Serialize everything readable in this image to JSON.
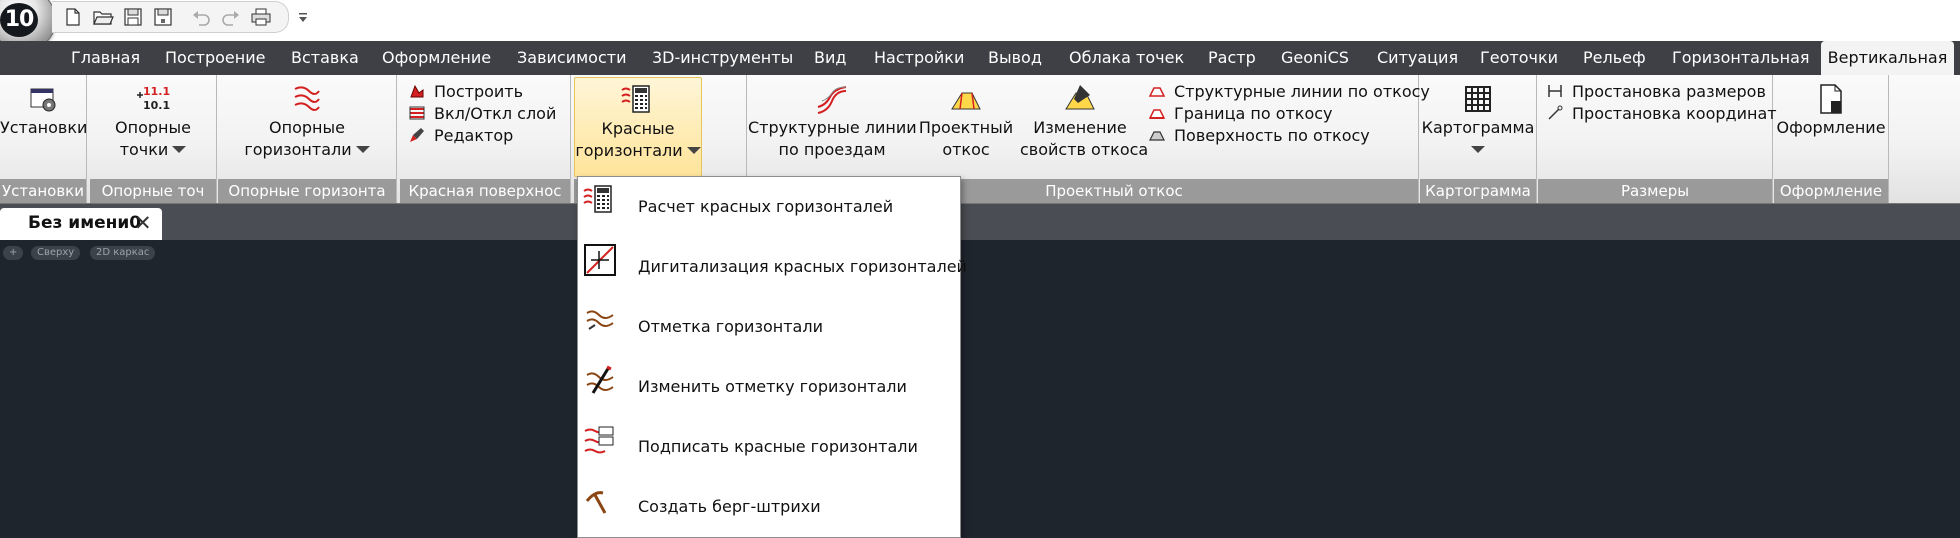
{
  "app": {
    "orb_label": "10"
  },
  "quick_access": {
    "buttons": [
      "new-file-icon",
      "open-folder-icon",
      "save-icon",
      "save-as-icon",
      "undo-icon",
      "redo-icon",
      "print-icon"
    ],
    "customize_icon": "customize-dropdown-icon"
  },
  "menu_tabs": [
    "Главная",
    "Построение",
    "Вставка",
    "Оформление",
    "Зависимости",
    "3D-инструменты",
    "Вид",
    "Настройки",
    "Вывод",
    "Облака точек",
    "Растр",
    "GeoniCS",
    "Ситуация",
    "Геоточки",
    "Рельеф",
    "Горизонтальная",
    "Вертикальная"
  ],
  "active_tab": "Вертикальная",
  "ribbon": {
    "panels": {
      "settings": {
        "title": "Установки",
        "button": "Установки"
      },
      "ref_points": {
        "title": "Опорные точ",
        "button_line1": "Опорные",
        "button_line2": "точки",
        "icon_text1": "11.1",
        "icon_text2": "10.1"
      },
      "ref_contours": {
        "title": "Опорные горизонта",
        "button_line1": "Опорные",
        "button_line2": "горизонтали"
      },
      "red_surface": {
        "title": "Красная поверхнос",
        "items": [
          "Построить",
          "Вкл/Откл слой",
          "Редактор"
        ]
      },
      "red_contours": {
        "button_line1": "Красные",
        "button_line2": "горизонтали"
      },
      "structural": {
        "button_line1": "Структурные линии",
        "button_line2": "по проездам"
      },
      "design_slope": {
        "title": "Проектный откос",
        "btn1_line1": "Проектный",
        "btn1_line2": "откос",
        "btn2_line1": "Изменение",
        "btn2_line2": "свойств откоса",
        "items": [
          "Структурные линии по откосу",
          "Граница по откосу",
          "Поверхность по откосу"
        ]
      },
      "cartogram": {
        "title": "Картограмма",
        "button": "Картограмма"
      },
      "dimensions": {
        "title": "Размеры",
        "items": [
          "Простановка размеров",
          "Простановка координат"
        ]
      },
      "formatting": {
        "title": "Оформление",
        "button": "Оформление"
      }
    }
  },
  "document": {
    "tab_label": "Без имени0",
    "close_glyph": "✕"
  },
  "viewport": {
    "chips": [
      "+",
      "Сверху",
      "2D каркас"
    ],
    "background": "#1f252d"
  },
  "dropdown": {
    "items": [
      {
        "label": "Расчет красных горизонталей",
        "icon": "calc-red-contours-icon"
      },
      {
        "label": "Дигитализация красных горизонталей",
        "icon": "digitize-red-contours-icon"
      },
      {
        "label": "Отметка горизонтали",
        "icon": "contour-elevation-icon"
      },
      {
        "label": "Изменить отметку горизонтали",
        "icon": "edit-contour-elevation-icon"
      },
      {
        "label": "Подписать красные горизонтали",
        "icon": "label-red-contours-icon"
      },
      {
        "label": "Создать берг-штрихи",
        "icon": "slope-ticks-icon"
      }
    ]
  },
  "colors": {
    "tabbar": "#3e4045",
    "panel_title": "#9a9a9a",
    "accent_red": "#d42020",
    "pressed": "#ffe49a"
  }
}
